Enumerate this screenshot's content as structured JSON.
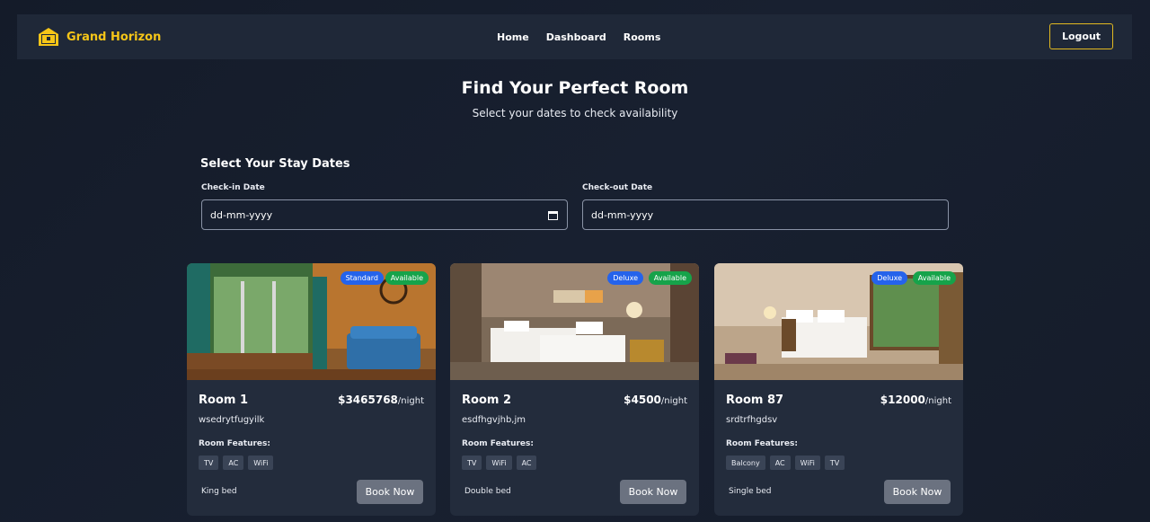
{
  "brand": {
    "name": "Grand Horizon",
    "icon": "house-icon"
  },
  "nav": {
    "links": [
      "Home",
      "Dashboard",
      "Rooms"
    ],
    "logout_label": "Logout"
  },
  "hero": {
    "title": "Find Your Perfect Room",
    "subtitle": "Select your dates to check availability"
  },
  "dates": {
    "section_title": "Select Your Stay Dates",
    "checkin": {
      "label": "Check-in Date",
      "placeholder": "dd-mm-yyyy",
      "icon": "calendar-icon"
    },
    "checkout": {
      "label": "Check-out Date",
      "placeholder": "dd-mm-yyyy"
    }
  },
  "rooms": [
    {
      "name": "Room 1",
      "price": "$3465768",
      "per": "/night",
      "description": "wsedrytfugyilk",
      "type_badge": "Standard",
      "status_badge": "Available",
      "features_title": "Room Features:",
      "features": [
        "TV",
        "AC",
        "WiFi"
      ],
      "bed": "King bed",
      "book_label": "Book Now"
    },
    {
      "name": "Room 2",
      "price": "$4500",
      "per": "/night",
      "description": "esdfhgvjhb,jm",
      "type_badge": "Deluxe",
      "status_badge": "Available",
      "features_title": "Room Features:",
      "features": [
        "TV",
        "WiFi",
        "AC"
      ],
      "bed": "Double bed",
      "book_label": "Book Now"
    },
    {
      "name": "Room 87",
      "price": "$12000",
      "per": "/night",
      "description": "srdtrfhgdsv",
      "type_badge": "Deluxe",
      "status_badge": "Available",
      "features_title": "Room Features:",
      "features": [
        "Balcony",
        "AC",
        "WiFi",
        "TV"
      ],
      "bed": "Single bed",
      "book_label": "Book Now"
    }
  ],
  "colors": {
    "accent": "#f5c518",
    "type_badge": "#2563eb",
    "available_badge": "#16a34a",
    "book_button": "#6b7280"
  }
}
